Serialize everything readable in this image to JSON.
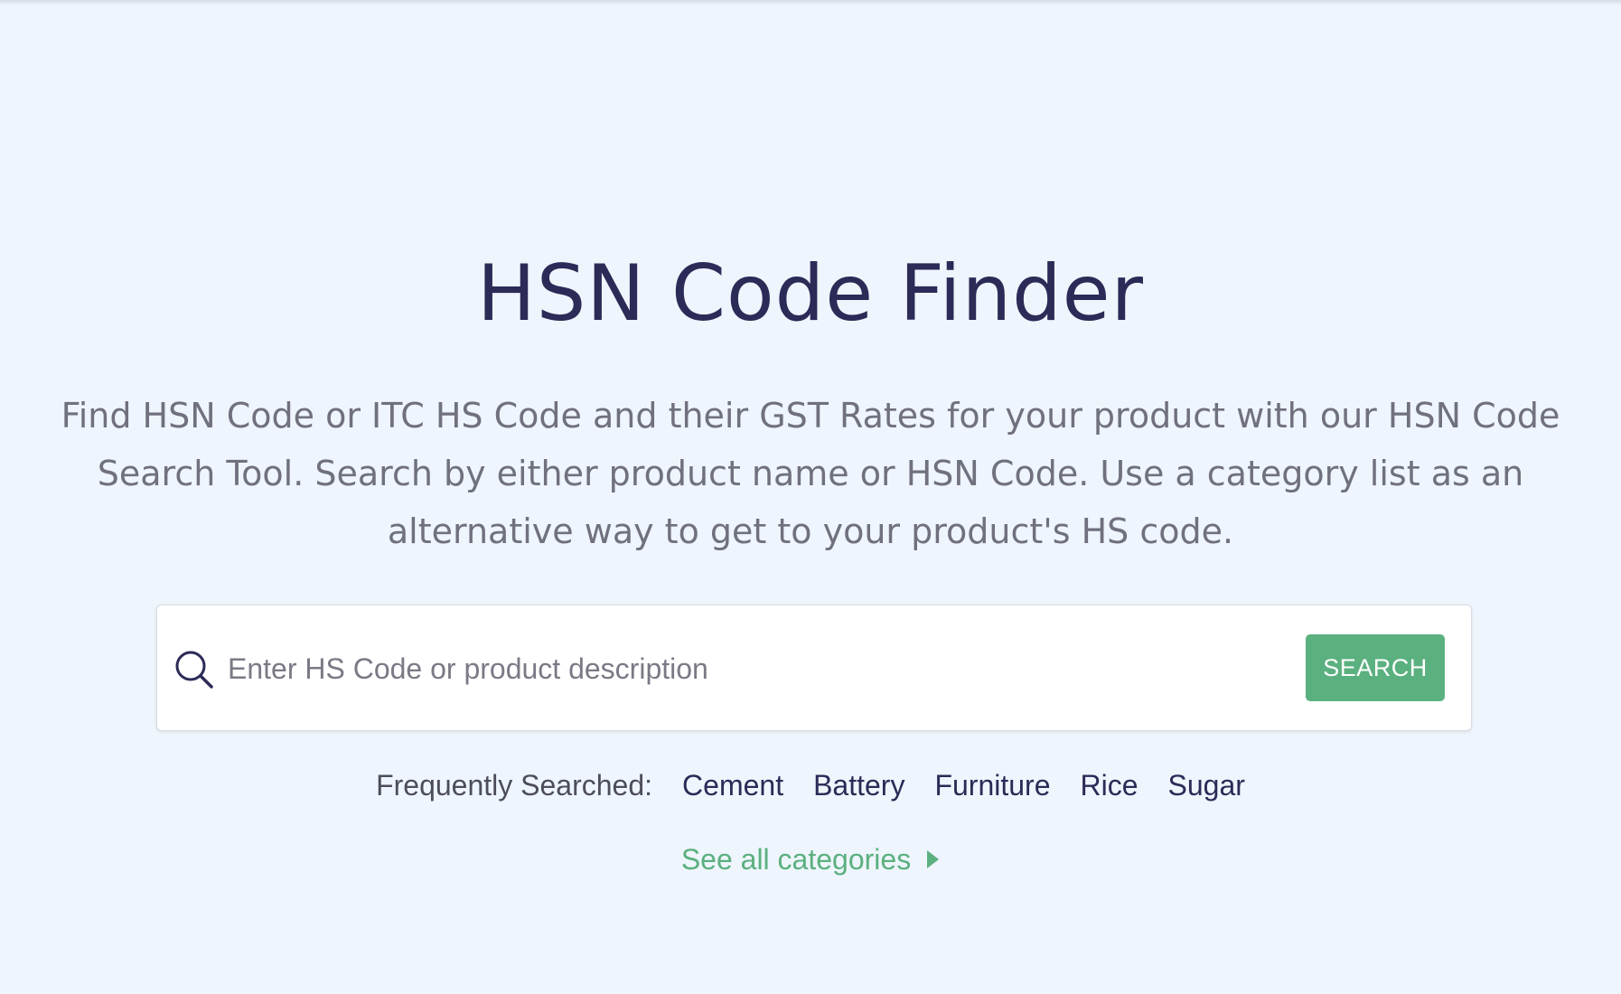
{
  "hero": {
    "title": "HSN Code Finder",
    "description": "Find HSN Code or ITC HS Code and their GST Rates for your product with our HSN Code Search Tool. Search by either product name or HSN Code. Use a category list as an alternative way to get to your product's HS code."
  },
  "search": {
    "icon": "search-icon",
    "placeholder": "Enter HS Code or product description",
    "value": "",
    "button_label": "SEARCH"
  },
  "frequently_searched": {
    "label": "Frequently Searched:",
    "items": [
      "Cement",
      "Battery",
      "Furniture",
      "Rice",
      "Sugar"
    ]
  },
  "see_all": {
    "label": "See all categories",
    "icon": "caret-right-icon"
  },
  "colors": {
    "background": "#eef5fc",
    "title": "#2c2a57",
    "accent_green": "#5bb07f",
    "muted_text": "#70707e"
  }
}
